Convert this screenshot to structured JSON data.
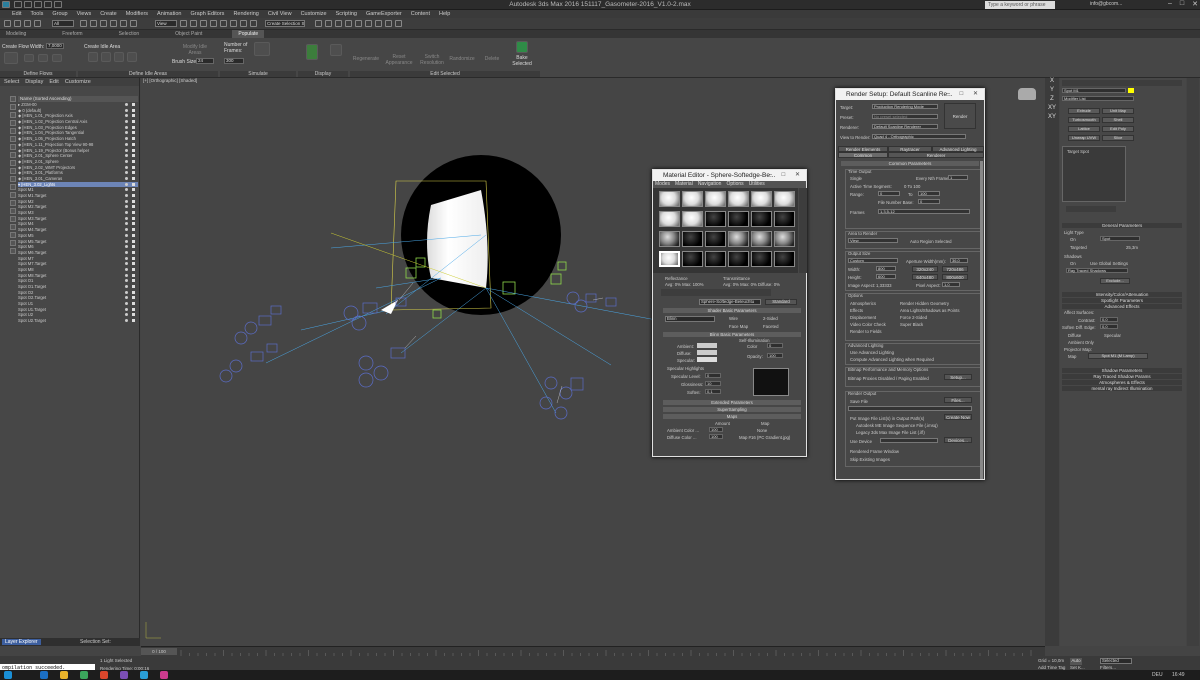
{
  "titlebar": {
    "title": "Autodesk 3ds Max 2016      151117_Gasometer-2016_V1.0-2.max",
    "search_placeholder": "Type a keyword or phrase",
    "user": "info@gbcom..."
  },
  "menubar": [
    "Edit",
    "Tools",
    "Group",
    "Views",
    "Create",
    "Modifiers",
    "Animation",
    "Graph Editors",
    "Rendering",
    "Civil View",
    "Customize",
    "Scripting",
    "GameExporter",
    "Content",
    "Help"
  ],
  "maintoolbar": {
    "selection_filter": "All",
    "view": "View",
    "named_sel": "Create Selection Se"
  },
  "ribbon": {
    "tabs": [
      "Modeling",
      "Freeform",
      "Selection",
      "Object Paint",
      "Populate"
    ],
    "active_tab": "Populate",
    "create_flow": "Create Flow",
    "width_label": "Width:",
    "width_value": "7,0000",
    "create_idle_area": "Create Idle Area",
    "modify_idle_areas": "Modify Idle Areas",
    "brush_size_label": "Brush Size:",
    "brush_size_value": "24",
    "number_of_frames": "Number of Frames:",
    "frames_value": "300",
    "simulate": "Simulate",
    "regenerate": "Regenerate",
    "reset_appearance": "Reset Appearance",
    "switch_resolution": "Switch Resolution",
    "randomize": "Randomize",
    "delete": "Delete",
    "bake_selected": "Bake Selected",
    "groups": [
      "Define Flows",
      "Define Idle Areas",
      "Simulate",
      "Display",
      "Edit Selected"
    ]
  },
  "layer_explorer": {
    "menu": [
      "Select",
      "Display",
      "Edit",
      "Customize"
    ],
    "header": "Name (Sorted Ascending)",
    "rows": [
      "▸ ZGM-00",
      "  ◆ 0 (default)",
      "  ◆ [HEN_1.01_Projection Axis",
      "  ◆ [HEN_1.02_Projection Central Axis",
      "  ◆ [HEN_1.03_Projection Edges",
      "  ◆ [HEN_1.04_Projection Tangential",
      "  ◆ [HEN_1.05_Projection Hatch",
      "  ◆ [HEN_1.11_Projection Top View 90-98",
      "  ◆ [HEN_1.19_Projector (Bonus helper",
      "  ◆ [HEN_2.01_Sphere Center",
      "  ◆ [HEN_2.01_Sphere",
      "  ◆ [HEN_2.02_WMT Projectors",
      "  ◆ [HEN_3.01_Platforms",
      "  ◆ [HEN_3.01_Cameras",
      "  ▾ [HEN_3.02_Lights",
      "      Spot M1",
      "      Spot M1.Target",
      "      Spot M2",
      "      Spot M2.Target",
      "      Spot M3",
      "      Spot M3.Target",
      "      Spot M4",
      "      Spot M4.Target",
      "      Spot M5",
      "      Spot M5.Target",
      "      Spot M6",
      "      Spot M6.Target",
      "      Spot M7",
      "      Spot M7.Target",
      "      Spot M8",
      "      Spot M8.Target",
      "      Spot O1",
      "      Spot O1.Target",
      "      Spot O2",
      "      Spot O2.Target",
      "      Spot U1",
      "      Spot U1.Target",
      "      Spot U2",
      "      Spot U2.Target"
    ],
    "selected_index": 14,
    "bottom_tab": "Layer Explorer",
    "bottom_set": "Selection Set:"
  },
  "viewport": {
    "label": "[+] [Orthographic] [Shaded]"
  },
  "material_editor": {
    "title": "Material Editor - Sphere-Softedge-Be...",
    "menu": [
      "Modes",
      "Material",
      "Navigation",
      "Options",
      "Utilities"
    ],
    "reflectance_label": "Reflectance",
    "reflectance_vals": "Avg:   0%  Max:   100%",
    "transmittance_label": "Transmittance",
    "transmittance_vals": "Avg:   0%  Max:   0%  Diffuse:   0%",
    "material_name": "Sphere-Softedge-Beleuchtu",
    "material_type": "Standard",
    "shader_basic": "Shader Basic Parameters",
    "blinn": "Blinn",
    "wire": "Wire",
    "two_sided": "2-Sided",
    "face_map": "Face Map",
    "faceted": "Faceted",
    "blinn_basic": "Blinn Basic Parameters",
    "self_illum": "Self-Illumination",
    "color": "Color",
    "color_val": "0",
    "ambient": "Ambient:",
    "diffuse": "Diffuse:",
    "specular": "Specular:",
    "opacity": "Opacity:",
    "opacity_val": "100",
    "spec_highlights": "Specular Highlights",
    "spec_level": "Specular Level:",
    "spec_level_val": "0",
    "glossiness": "Glossiness:",
    "glossiness_val": "10",
    "soften": "Soften:",
    "soften_val": "0,1",
    "extended": "Extended Parameters",
    "supersampling": "SuperSampling",
    "maps": "Maps",
    "amount": "Amount",
    "map_col": "Map",
    "ambient_color": "Ambient Color ...",
    "ambient_amount": "100",
    "ambient_map": "None",
    "diffuse_color": "Diffuse Color ...",
    "diffuse_amount": "100",
    "diffuse_map": "Map #16 (PC Gradient.jpg)"
  },
  "render_setup": {
    "title": "Render Setup: Default Scanline Re...",
    "target_label": "Target:",
    "target": "Production Rendering Mode",
    "preset_label": "Preset:",
    "preset": "No preset selected",
    "renderer_label": "Renderer:",
    "renderer": "Default Scanline Renderer",
    "view_label": "View to Render:",
    "view": "Quad 4 - Orthographic",
    "render_btn": "Render",
    "tabs": [
      "Render Elements",
      "Raytracer",
      "Advanced Lighting",
      "Common",
      "Renderer"
    ],
    "common_params": "Common Parameters",
    "time_output": "Time Output",
    "single": "Single",
    "every_nth": "Every Nth Frame:",
    "every_nth_val": "1",
    "active_segment": "Active Time Segment:",
    "active_segment_val": "0 To 100",
    "range": "Range:",
    "range_from": "0",
    "to": "To",
    "range_to": "100",
    "file_number_base": "File Number Base:",
    "file_number_val": "0",
    "frames": "Frames",
    "frames_val": "1,3,5-12",
    "area_to_render": "Area to Render",
    "area": "View",
    "auto_region": "Auto Region Selected",
    "output_size": "Output Size",
    "custom": "Custom",
    "aperture": "Aperture Width(mm):",
    "aperture_val": "36,0",
    "width": "Width:",
    "width_val": "800",
    "height": "Height:",
    "height_val": "600",
    "sizes": [
      "320x240",
      "720x486",
      "640x480",
      "800x600"
    ],
    "image_aspect": "Image Aspect:",
    "image_aspect_val": "1,33333",
    "pixel_aspect": "Pixel Aspect:",
    "pixel_aspect_val": "1,0",
    "options": "Options",
    "atmospherics": "Atmospherics",
    "render_hidden": "Render Hidden Geometry",
    "effects": "Effects",
    "area_lights": "Area Lights/Shadows as Points",
    "displacement": "Displacement",
    "force_2sided": "Force 2-Sided",
    "video_color": "Video Color Check",
    "super_black": "Super Black",
    "render_fields": "Render to Fields",
    "adv_lighting": "Advanced Lighting",
    "use_adv": "Use Advanced Lighting",
    "compute_adv": "Compute Advanced Lighting when Required",
    "bitmap_perf": "Bitmap Performance and Memory Options",
    "bitmap_proxies": "Bitmap Proxies Disabled / Paging Enabled",
    "setup_btn": "Setup...",
    "render_output": "Render Output",
    "save_file": "Save File",
    "files_btn": "Files...",
    "put_image": "Put Image File List(s) in Output Path(s)",
    "create_now": "Create Now",
    "autodesk_seq": "Autodesk ME Image Sequence File (.imsq)",
    "legacy_seq": "Legacy 3ds Max Image File List (.ifl)",
    "use_device": "Use Device",
    "devices_btn": "Devices...",
    "rendered_frame": "Rendered Frame Window",
    "skip_existing": "Skip Existing Images"
  },
  "command_panel": {
    "object_name": "Spot M1",
    "modifier_list": "Modifier List",
    "buttons": [
      "Extrude",
      "Unit Map",
      "Turbosmooth",
      "Shell",
      "Lattice",
      "Edit Poly",
      "Unwrap UVW",
      "Slice"
    ],
    "stack_item": "Target Spot",
    "general_params": "General Parameters",
    "light_type": "Light Type",
    "on": "On",
    "type": "Spot",
    "targeted": "Targeted",
    "target_val": "25,3m",
    "shadows": "Shadows",
    "use_global": "Use Global Settings",
    "ray_shadows": "Ray Traced Shadows",
    "exclude": "Exclude...",
    "intensity": "Intensity/Color/Attenuation",
    "spotlight": "Spotlight Parameters",
    "adv_effects": "Advanced Effects",
    "affect_surfaces": "Affect Surfaces:",
    "contrast": "Contrast:",
    "contrast_val": "0,0",
    "soften_edge": "Soften Diff. Edge:",
    "soften_edge_val": "0,0",
    "diffuse": "Diffuse",
    "specular": "Specular",
    "ambient_only": "Ambient Only",
    "projector_map": "Projector Map:",
    "map": "Map",
    "map_name": "Spot M1 (M Lamp)",
    "shadow_params": "Shadow Parameters",
    "ray_params": "Ray Traced Shadow Params",
    "atmos": "Atmospheres & Effects",
    "mental_ray": "mental ray Indirect Illumination"
  },
  "timeline": {
    "frame": "0 / 100"
  },
  "status": {
    "maxscript": "ompilation succeeded.",
    "selected": "1 Light Selected",
    "render_time": "Rendering Time: 0:00:16",
    "grid": "Grid = 10,0m",
    "add_time_tag": "Add Time Tag",
    "auto_key": "Auto",
    "selected_dd": "Selected",
    "set_key": "Set K...",
    "filters": "Filters...",
    "lang": "DEU",
    "clock": "16:49"
  },
  "colors": {
    "accent": "#3c5e9e",
    "selection": "#6d85b7",
    "viewport": "#454545"
  }
}
